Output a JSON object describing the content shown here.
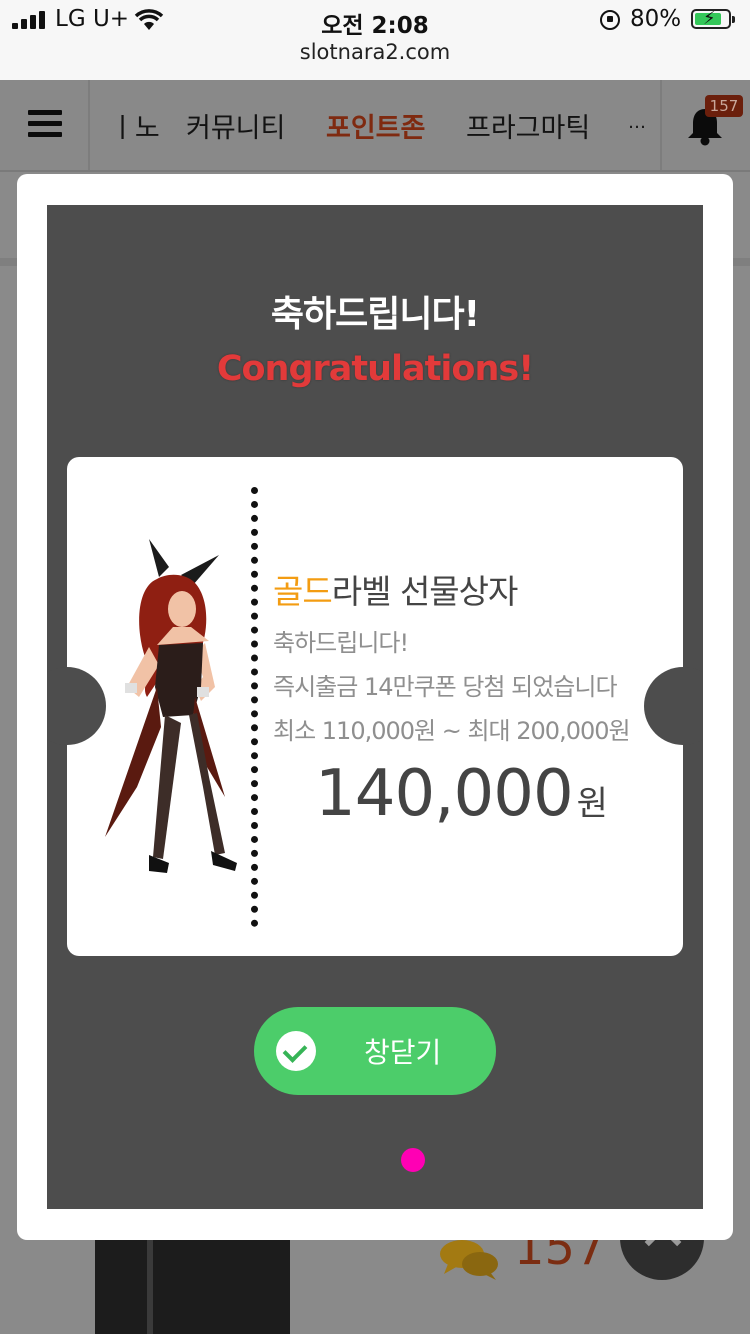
{
  "status_bar": {
    "carrier": "LG U+",
    "time": "오전 2:08",
    "url": "slotnara2.com",
    "battery_percent": "80%",
    "battery_level": 0.8,
    "battery_charging": true
  },
  "nav": {
    "tabs": [
      {
        "label": "카지노",
        "visible_text": "ㅣ노"
      },
      {
        "label": "커뮤니티"
      },
      {
        "label": "포인트존",
        "active": true
      },
      {
        "label": "프라그마틱"
      },
      {
        "label": "…"
      }
    ],
    "notification_count": "157"
  },
  "background": {
    "chat_count": "157"
  },
  "popup": {
    "title_ko": "축하드립니다!",
    "title_en": "Congratulations!",
    "prize": {
      "name_accent": "골드",
      "name_rest": "라벨 선물상자",
      "line1": "축하드립니다!",
      "line2": "즉시출금 14만쿠폰 당첨 되었습니다",
      "line3": "최소 110,000원 ~ 최대 200,000원",
      "amount": "140,000",
      "unit": "원"
    },
    "close_label": "창닫기"
  },
  "colors": {
    "accent_orange": "#f39c12",
    "congrats_red": "#e23a3a",
    "button_green": "#4ccd6a",
    "page_dot": "#ff00b4"
  }
}
